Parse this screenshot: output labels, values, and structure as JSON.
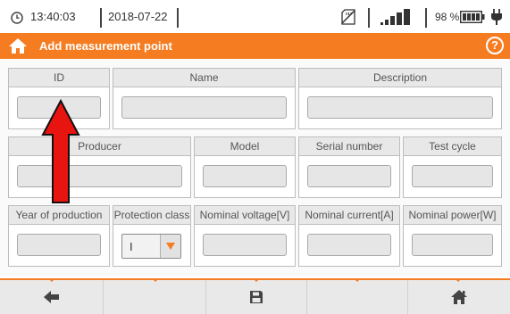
{
  "status": {
    "time": "13:40:03",
    "date": "2018-07-22",
    "battery_percent": "98 %",
    "battery_level": 0.98,
    "icons": [
      "clock-icon",
      "sd-card-icon",
      "signal-icon",
      "battery-icon",
      "plug-icon"
    ]
  },
  "header": {
    "title": "Add measurement point",
    "help_label": "?"
  },
  "form": {
    "id": {
      "label": "ID",
      "value": ""
    },
    "name": {
      "label": "Name",
      "value": ""
    },
    "description": {
      "label": "Description",
      "value": ""
    },
    "producer": {
      "label": "Producer",
      "value": ""
    },
    "model": {
      "label": "Model",
      "value": ""
    },
    "serial_number": {
      "label": "Serial number",
      "value": ""
    },
    "test_cycle": {
      "label": "Test cycle",
      "value": ""
    },
    "year_of_production": {
      "label": "Year of production",
      "value": ""
    },
    "protection_class": {
      "label": "Protection class",
      "value": "I"
    },
    "nominal_voltage": {
      "label": "Nominal voltage[V]",
      "value": ""
    },
    "nominal_current": {
      "label": "Nominal current[A]",
      "value": ""
    },
    "nominal_power": {
      "label": "Nominal power[W]",
      "value": ""
    }
  },
  "toolbar": {
    "buttons": [
      "back-icon",
      "",
      "save-icon",
      "",
      "home-icon"
    ]
  },
  "colors": {
    "accent": "#f57c21",
    "annotation_arrow": "#e8140f"
  }
}
